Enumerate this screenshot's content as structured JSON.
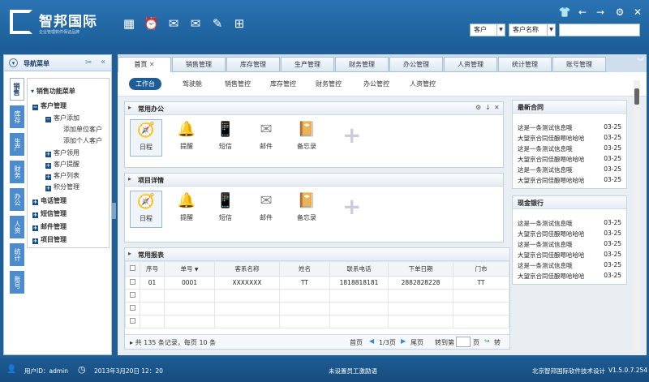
{
  "header": {
    "title": "智邦国际",
    "subtitle": "企业管理软件保证品牌",
    "select_customer": "客户",
    "select_field": "客户名称",
    "search_value": ""
  },
  "sidebar": {
    "title": "导航菜单",
    "vtabs": [
      "销售",
      "库存",
      "生产",
      "财务",
      "办公",
      "人资",
      "统计",
      "账号"
    ],
    "tree": {
      "root": "销售功能菜单",
      "customer": "客户管理",
      "c_add": "客户添加",
      "c_add_unit": "添加单位客户",
      "c_add_person": "添加个人客户",
      "c_claim": "客户领用",
      "c_remind": "客户提醒",
      "c_list": "客户列表",
      "c_points": "积分管理",
      "phone": "电话管理",
      "sms": "短信管理",
      "mail": "邮件管理",
      "project": "项目管理"
    }
  },
  "tabs": [
    "首页",
    "销售管理",
    "库存管理",
    "生产管理",
    "财务管理",
    "办公管理",
    "人资管理",
    "统计管理",
    "账号管理"
  ],
  "subnav": [
    "工作台",
    "驾驶舱",
    "销售管控",
    "库存管控",
    "财务管控",
    "办公管控",
    "人资管控"
  ],
  "panel_office": {
    "title": "常用办公",
    "items": [
      "日程",
      "提醒",
      "短信",
      "邮件",
      "备忘录"
    ]
  },
  "panel_project": {
    "title": "项目详情",
    "items": [
      "日程",
      "提醒",
      "短信",
      "邮件",
      "备忘录"
    ]
  },
  "panel_report": {
    "title": "常用报表",
    "headers": [
      "序号",
      "单号",
      "客系名称",
      "姓名",
      "联系电话",
      "下单日期",
      "门市"
    ],
    "row": [
      "01",
      "0001",
      "XXXXXXX",
      "TT",
      "1818818181",
      "2882828228",
      "TT"
    ],
    "pager_info": "共 135 条记录，每页 10 条",
    "first": "首页",
    "page": "1/3页",
    "last": "尾页",
    "goto": "转到第",
    "page_unit": "页",
    "go": "转"
  },
  "contracts": {
    "title": "最新合同",
    "items": [
      "这是一条测试信息哦",
      "大望京合同佳酿嗯哈哈哈",
      "这是一条测试信息哦",
      "大望京合同佳酿嗯哈哈哈",
      "这是一条测试信息哦",
      "大望京合同佳酿嗯哈哈哈"
    ],
    "dates": [
      "03-25",
      "03-25",
      "03-25",
      "03-25",
      "03-25",
      "03-25"
    ]
  },
  "bank": {
    "title": "现金银行",
    "items": [
      "这是一条测试信息哦",
      "大望京合同佳酿嗯哈哈哈",
      "这是一条测试信息哦",
      "大望京合同佳酿嗯哈哈哈",
      "这是一条测试信息哦",
      "大望京合同佳酿嗯哈哈哈"
    ],
    "dates": [
      "03-25",
      "03-25",
      "03-25",
      "03-25",
      "03-25",
      "03-25"
    ]
  },
  "footer": {
    "user": "用户ID：admin",
    "date": "2013年3月20日 12：20",
    "notice": "未设置员工激励语",
    "company": "北京智邦国际软件技术设计",
    "version": "V1.5.0.7.254"
  },
  "colors": {
    "brand": "#1d5c94",
    "accent": "#4d8ccc"
  }
}
